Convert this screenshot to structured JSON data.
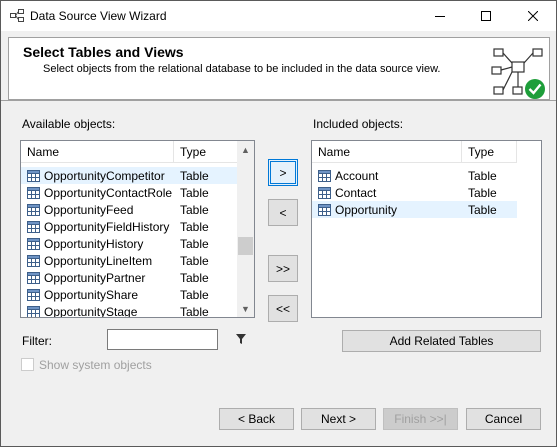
{
  "window": {
    "title": "Data Source View Wizard"
  },
  "header": {
    "title": "Select Tables and Views",
    "subtitle": "Select objects from the relational database to be included in the data source view."
  },
  "available": {
    "label": "Available objects:",
    "columns": {
      "name": "Name",
      "type": "Type"
    },
    "rows": [
      {
        "name": "OpportunityCompetitor",
        "type": "Table",
        "selected": true
      },
      {
        "name": "OpportunityContactRole",
        "type": "Table"
      },
      {
        "name": "OpportunityFeed",
        "type": "Table"
      },
      {
        "name": "OpportunityFieldHistory",
        "type": "Table"
      },
      {
        "name": "OpportunityHistory",
        "type": "Table"
      },
      {
        "name": "OpportunityLineItem",
        "type": "Table"
      },
      {
        "name": "OpportunityPartner",
        "type": "Table"
      },
      {
        "name": "OpportunityShare",
        "type": "Table"
      },
      {
        "name": "OpportunityStage",
        "type": "Table"
      }
    ]
  },
  "included": {
    "label": "Included objects:",
    "columns": {
      "name": "Name",
      "type": "Type"
    },
    "rows": [
      {
        "name": "Account",
        "type": "Table"
      },
      {
        "name": "Contact",
        "type": "Table"
      },
      {
        "name": "Opportunity",
        "type": "Table",
        "selected": true
      }
    ]
  },
  "transfer": {
    "add": ">",
    "remove": "<",
    "add_all": ">>",
    "remove_all": "<<"
  },
  "filter": {
    "label": "Filter:",
    "value": ""
  },
  "show_system": {
    "label": "Show system objects",
    "checked": false
  },
  "add_related": "Add Related Tables",
  "footer": {
    "back": "< Back",
    "next": "Next >",
    "finish": "Finish >>|",
    "cancel": "Cancel"
  },
  "colors": {
    "selection": "#e5f3ff",
    "focus": "#0078d7",
    "check_green": "#1e9e3a"
  }
}
